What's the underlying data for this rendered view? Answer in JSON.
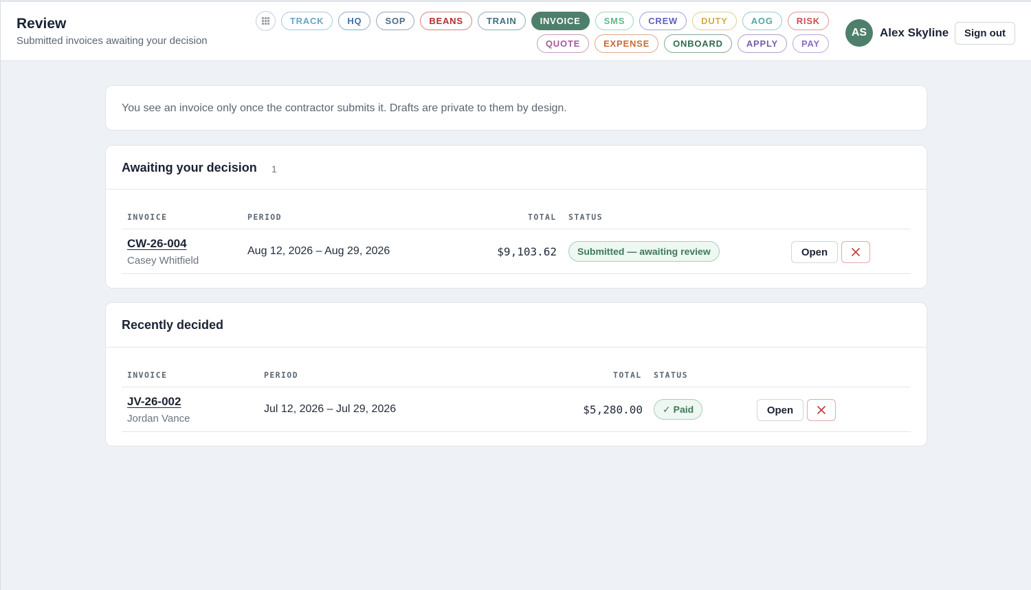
{
  "header": {
    "title": "Review",
    "subtitle": "Submitted invoices awaiting your decision",
    "apps_icon": "grid-icon",
    "nav_row1": [
      {
        "label": "TRACK",
        "color": "#6aa3c4"
      },
      {
        "label": "HQ",
        "color": "#3f6fa3"
      },
      {
        "label": "SOP",
        "color": "#4a6a86"
      },
      {
        "label": "BEANS",
        "color": "#b0302e"
      },
      {
        "label": "TRAIN",
        "color": "#3d7080"
      },
      {
        "label": "INVOICE",
        "color": "#4e7f6b",
        "active": true
      },
      {
        "label": "SMS",
        "color": "#5fb98a"
      },
      {
        "label": "CREW",
        "color": "#5b5fc7"
      },
      {
        "label": "DUTY",
        "color": "#d6a94a"
      },
      {
        "label": "AOG",
        "color": "#4fa8a0"
      },
      {
        "label": "RISK",
        "color": "#c94e4e"
      }
    ],
    "nav_row2": [
      {
        "label": "QUOTE",
        "color": "#a45b95"
      },
      {
        "label": "EXPENSE",
        "color": "#c76a35"
      },
      {
        "label": "ONBOARD",
        "color": "#2f6b4e"
      },
      {
        "label": "APPLY",
        "color": "#7a5ba8"
      },
      {
        "label": "PAY",
        "color": "#8a6bc0"
      }
    ],
    "user": {
      "initials": "AS",
      "name": "Alex Skyline"
    },
    "signout_label": "Sign out"
  },
  "notice": "You see an invoice only once the contractor submits it. Drafts are private to them by design.",
  "awaiting": {
    "title": "Awaiting your decision",
    "count": "1",
    "columns": {
      "invoice": "INVOICE",
      "period": "PERIOD",
      "total": "TOTAL",
      "status": "STATUS"
    },
    "rows": [
      {
        "id": "CW-26-004",
        "name": "Casey Whitfield",
        "period": "Aug 12, 2026 – Aug 29, 2026",
        "total": "$9,103.62",
        "status": "Submitted — awaiting review",
        "open_label": "Open",
        "reject_icon": "close-icon"
      }
    ]
  },
  "recent": {
    "title": "Recently decided",
    "columns": {
      "invoice": "INVOICE",
      "period": "PERIOD",
      "total": "TOTAL",
      "status": "STATUS"
    },
    "rows": [
      {
        "id": "JV-26-002",
        "name": "Jordan Vance",
        "period": "Jul 12, 2026 – Jul 29, 2026",
        "total": "$5,280.00",
        "status": "✓ Paid",
        "open_label": "Open",
        "reject_icon": "close-icon"
      }
    ]
  }
}
